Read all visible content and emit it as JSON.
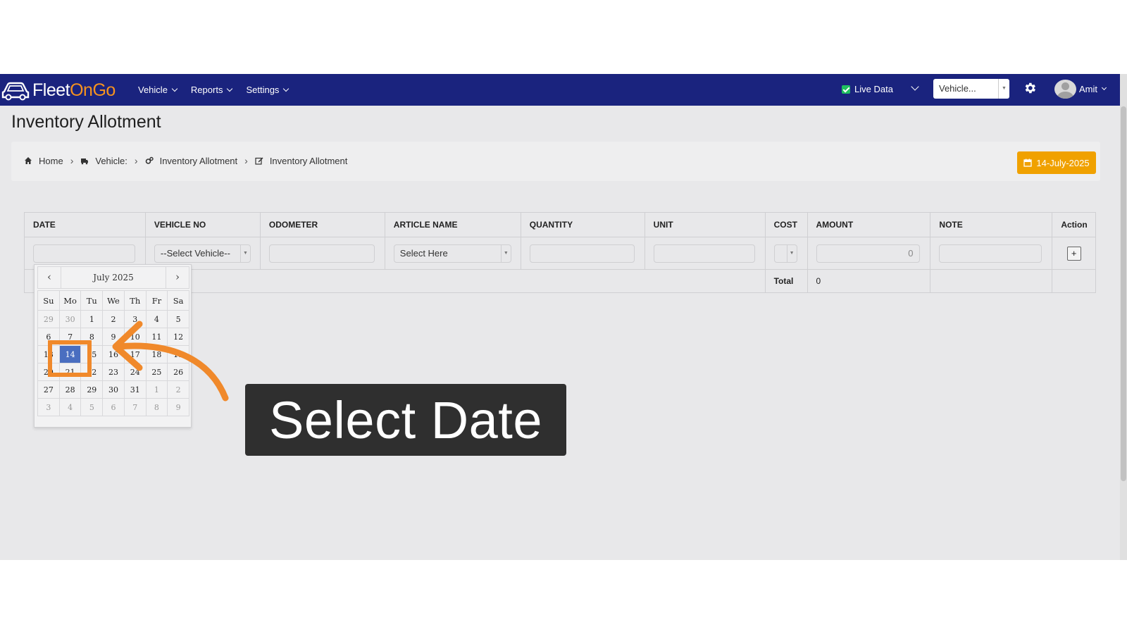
{
  "app": {
    "logo_text_a": "Fleet",
    "logo_text_b": "OnGo",
    "menu": [
      {
        "label": "Vehicle"
      },
      {
        "label": "Reports"
      },
      {
        "label": "Settings"
      }
    ],
    "live_data_label": "Live Data",
    "vehicle_select_value": "Vehicle...",
    "user_name": "Amit"
  },
  "page": {
    "title": "Inventory Allotment",
    "breadcrumb": [
      "Home",
      "Vehicle:",
      "Inventory Allotment",
      "Inventory Allotment"
    ],
    "date_badge": "14-July-2025"
  },
  "table": {
    "headers": [
      "DATE",
      "VEHICLE NO",
      "ODOMETER",
      "ARTICLE NAME",
      "QUANTITY",
      "UNIT",
      "COST",
      "AMOUNT",
      "NOTE",
      "Action"
    ],
    "vehicle_placeholder": "--Select Vehicle--",
    "article_placeholder": "Select Here",
    "amount_value": "0",
    "add_label": "+",
    "total_label": "Total",
    "total_value": "0"
  },
  "calendar": {
    "month_label": "July 2025",
    "prev": "‹",
    "next": "›",
    "weekdays": [
      "Su",
      "Mo",
      "Tu",
      "We",
      "Th",
      "Fr",
      "Sa"
    ],
    "weeks": [
      [
        "29",
        "30",
        "1",
        "2",
        "3",
        "4",
        "5"
      ],
      [
        "6",
        "7",
        "8",
        "9",
        "10",
        "11",
        "12"
      ],
      [
        "13",
        "14",
        "15",
        "16",
        "17",
        "18",
        "19"
      ],
      [
        "20",
        "21",
        "22",
        "23",
        "24",
        "25",
        "26"
      ],
      [
        "27",
        "28",
        "29",
        "30",
        "31",
        "1",
        "2"
      ],
      [
        "3",
        "4",
        "5",
        "6",
        "7",
        "8",
        "9"
      ]
    ],
    "selected_day": "14"
  },
  "annotation": {
    "banner_text": "Select Date",
    "color": "#f0892b"
  },
  "colors": {
    "navbar": "#1a237e",
    "accent": "#f0a100",
    "selected_day": "#4a6ec0"
  }
}
